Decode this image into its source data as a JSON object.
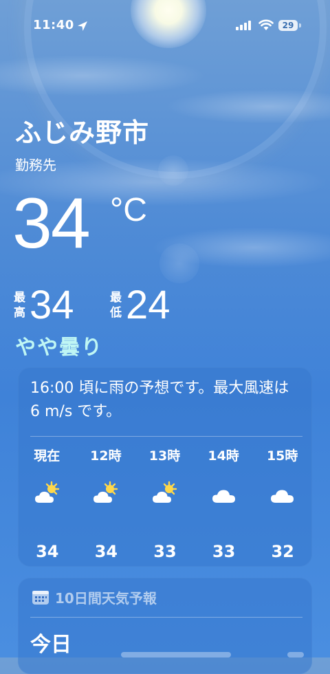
{
  "status_bar": {
    "time": "11:40",
    "battery": "29"
  },
  "header": {
    "city": "ふじみ野市",
    "subtitle": "勤務先",
    "temperature": "34",
    "unit": "°C",
    "high_label_1": "最",
    "high_label_2": "高",
    "high_value": "34",
    "low_label_1": "最",
    "low_label_2": "低",
    "low_value": "24",
    "condition": "やや曇り"
  },
  "hourly": {
    "summary": "16:00 頃に雨の予想です。最大風速は 6 m/s です。",
    "hours": [
      {
        "label": "現在",
        "icon": "partly-cloudy-sun-icon",
        "temp": "34"
      },
      {
        "label": "12時",
        "icon": "partly-cloudy-sun-icon",
        "temp": "34"
      },
      {
        "label": "13時",
        "icon": "partly-cloudy-sun-icon",
        "temp": "33"
      },
      {
        "label": "14時",
        "icon": "cloud-icon",
        "temp": "33"
      },
      {
        "label": "15時",
        "icon": "cloud-icon",
        "temp": "32"
      }
    ]
  },
  "forecast": {
    "title": "10日間天気予報",
    "today_label": "今日"
  },
  "colors": {
    "condition_text": "#bff6f4",
    "sun_yellow": "#ffd84a"
  }
}
